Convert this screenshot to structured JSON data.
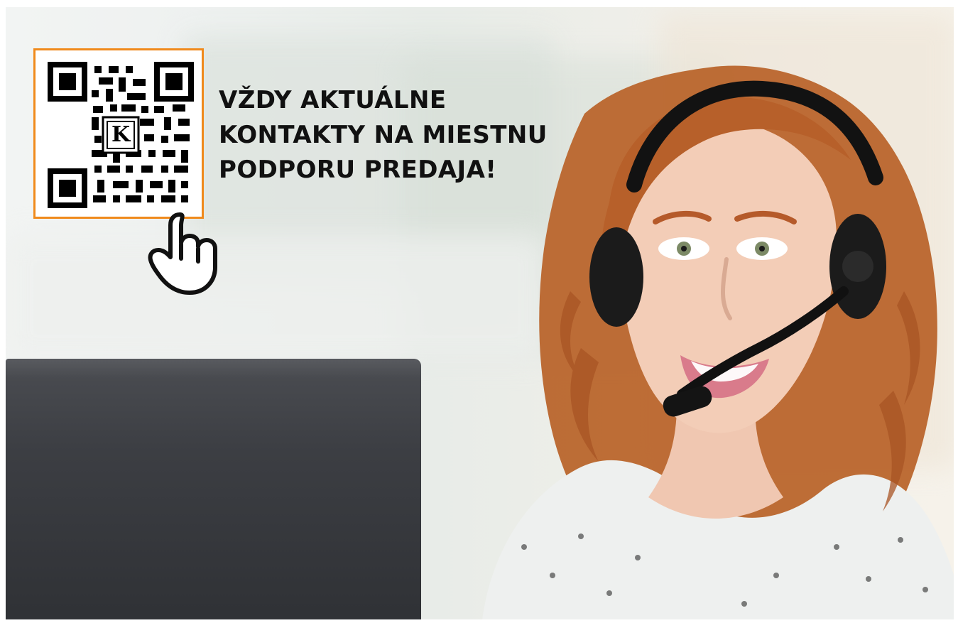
{
  "hero": {
    "headline_lines": [
      "VŽDY AKTUÁLNE",
      "KONTAKTY NA MIESTNU",
      "PODPORU PREDAJA!"
    ]
  },
  "qr": {
    "logo_letter": "K"
  },
  "colors": {
    "accent_orange": "#f08a1c",
    "text_dark": "#111111"
  },
  "icons": {
    "qr": "qr-code-icon",
    "hand": "hand-pointer-icon",
    "headset": "headset-icon"
  }
}
